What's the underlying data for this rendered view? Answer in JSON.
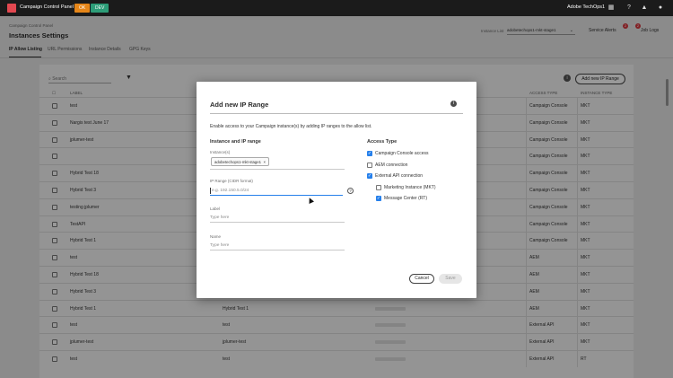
{
  "topbar": {
    "app_title": "Campaign Control Panel",
    "env_tags": [
      "OK",
      "DEV"
    ],
    "org_name": "Adobe TechOps1"
  },
  "header": {
    "breadcrumb": "Campaign Control Panel",
    "page_title": "Instances Settings",
    "instance_label": "Instance List",
    "instance_value": "adobetechops1-mkt-stage1",
    "service_alerts": "Service Alerts",
    "service_alerts_count": "2",
    "job_logs": "Job Logs",
    "job_logs_count": "2"
  },
  "tabs": [
    {
      "label": "IP Allow Listing"
    },
    {
      "label": "URL Permissions"
    },
    {
      "label": "Instance Details"
    },
    {
      "label": "GPG Keys"
    }
  ],
  "table": {
    "search_placeholder": "Search",
    "add_button": "Add new IP Range",
    "col_label": "LABEL",
    "col_access": "ACCESS TYPE",
    "col_type": "INSTANCE TYPE",
    "rows": [
      {
        "label": "test",
        "name": "",
        "access": "Campaign Console",
        "type": "MKT"
      },
      {
        "label": "Nargis test June 17",
        "name": "",
        "access": "Campaign Console",
        "type": "MKT"
      },
      {
        "label": "jplumer-test",
        "name": "",
        "access": "Campaign Console",
        "type": "MKT"
      },
      {
        "label": "",
        "name": "",
        "access": "Campaign Console",
        "type": "MKT"
      },
      {
        "label": "Hybrid Test 18",
        "name": "",
        "access": "Campaign Console",
        "type": "MKT"
      },
      {
        "label": "Hybrid Test 3",
        "name": "",
        "access": "Campaign Console",
        "type": "MKT"
      },
      {
        "label": "testing jplumer",
        "name": "",
        "access": "Campaign Console",
        "type": "MKT"
      },
      {
        "label": "TestAPI",
        "name": "",
        "access": "Campaign Console",
        "type": "MKT"
      },
      {
        "label": "Hybrid Test 1",
        "name": "",
        "access": "Campaign Console",
        "type": "MKT"
      },
      {
        "label": "test",
        "name": "",
        "access": "AEM",
        "type": "MKT"
      },
      {
        "label": "Hybrid Test 18",
        "name": "",
        "access": "AEM",
        "type": "MKT"
      },
      {
        "label": "Hybrid Test 3",
        "name": "",
        "access": "AEM",
        "type": "MKT"
      },
      {
        "label": "Hybrid Test 1",
        "name": "Hybrid Test 1",
        "access": "AEM",
        "type": "MKT"
      },
      {
        "label": "test",
        "name": "test",
        "access": "External API",
        "type": "MKT"
      },
      {
        "label": "jplumer-test",
        "name": "jplumer-test",
        "access": "External API",
        "type": "MKT"
      },
      {
        "label": "test",
        "name": "test",
        "access": "External API",
        "type": "RT"
      }
    ]
  },
  "modal": {
    "title": "Add new IP Range",
    "description": "Enable access to your Campaign instance(s) by adding IP ranges to the allow list.",
    "section_left": "Instance and IP range",
    "section_right": "Access Type",
    "instances_label": "Instance(s)",
    "instance_chip": "adobetechops1-mkt-stage1",
    "ip_label": "IP Range (CIDR format)",
    "ip_placeholder": "e.g. 192.150.5.0/24",
    "label_label": "Label",
    "label_placeholder": "Type here",
    "name_label": "Name",
    "name_placeholder": "Type here",
    "access_options": [
      {
        "label": "Campaign Console access",
        "checked": true
      },
      {
        "label": "AEM connection",
        "checked": false
      },
      {
        "label": "External API connection",
        "checked": true
      },
      {
        "label": "Marketing Instance (MKT)",
        "checked": false
      },
      {
        "label": "Message Center (RT)",
        "checked": true
      }
    ],
    "cancel": "Cancel",
    "save": "Save"
  }
}
